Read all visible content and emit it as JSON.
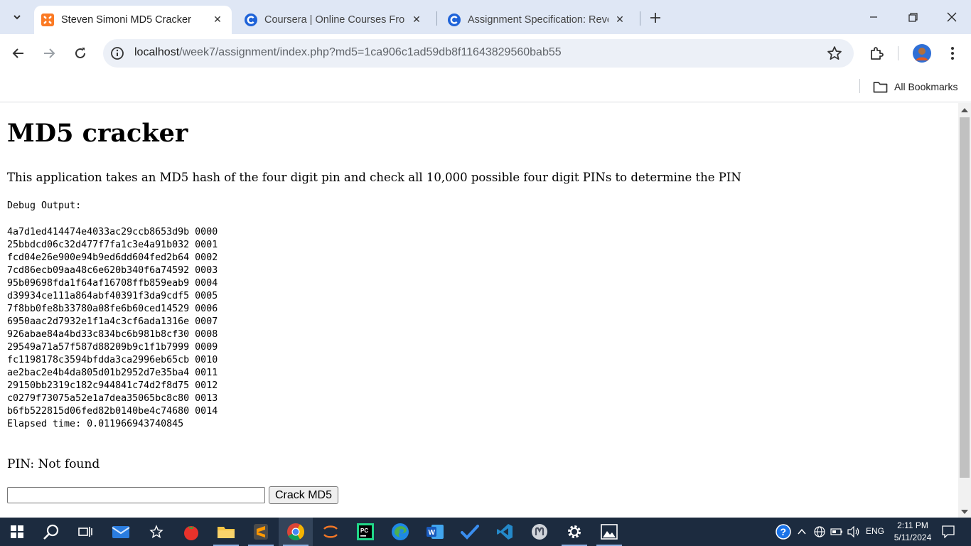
{
  "browser": {
    "tabs": [
      {
        "title": "Steven Simoni MD5 Cracker",
        "active": true,
        "favicon": "xampp-icon"
      },
      {
        "title": "Coursera | Online Courses From",
        "active": false,
        "favicon": "coursera-icon"
      },
      {
        "title": "Assignment Specification: Rever",
        "active": false,
        "favicon": "coursera-icon"
      }
    ],
    "url_host": "localhost",
    "url_path": "/week7/assignment/index.php?md5=1ca906c1ad59db8f11643829560bab55",
    "bookmarks_label": "All Bookmarks"
  },
  "page": {
    "title": "MD5 cracker",
    "description": "This application takes an MD5 hash of the four digit pin and check all 10,000 possible four digit PINs to determine the PIN",
    "debug_label": "Debug Output:",
    "debug_rows": [
      "4a7d1ed414474e4033ac29ccb8653d9b 0000",
      "25bbdcd06c32d477f7fa1c3e4a91b032 0001",
      "fcd04e26e900e94b9ed6dd604fed2b64 0002",
      "7cd86ecb09aa48c6e620b340f6a74592 0003",
      "95b09698fda1f64af16708ffb859eab9 0004",
      "d39934ce111a864abf40391f3da9cdf5 0005",
      "7f8bb0fe8b33780a08fe6b60ced14529 0006",
      "6950aac2d7932e1f1a4c3cf6ada1316e 0007",
      "926abae84a4bd33c834bc6b981b8cf30 0008",
      "29549a71a57f587d88209b9c1f1b7999 0009",
      "fc1198178c3594bfdda3ca2996eb65cb 0010",
      "ae2bac2e4b4da805d01b2952d7e35ba4 0011",
      "29150bb2319c182c944841c74d2f8d75 0012",
      "c0279f73075a52e1a7dea35065bc8c80 0013",
      "b6fb522815d06fed82b0140be4c74680 0014"
    ],
    "elapsed": "Elapsed time: 0.011966943740845",
    "pin_result": "PIN: Not found",
    "md5_input_value": "",
    "crack_button_label": "Crack MD5"
  },
  "taskbar": {
    "time": "2:11 PM",
    "date": "5/11/2024",
    "language": "ENG"
  }
}
